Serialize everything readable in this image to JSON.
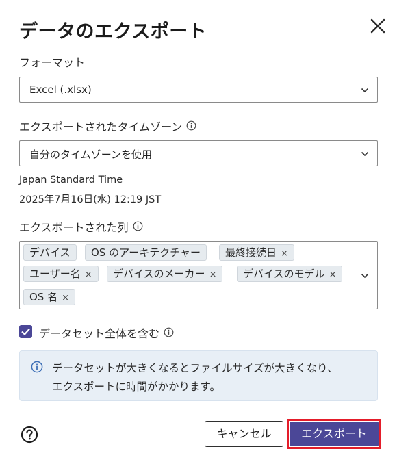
{
  "dialog": {
    "title": "データのエクスポート",
    "close_icon": "close-icon"
  },
  "format": {
    "label": "フォーマット",
    "value": "Excel (.xlsx)"
  },
  "timezone": {
    "label": "エクスポートされたタイムゾーン",
    "value": "自分のタイムゾーンを使用",
    "zone_name": "Japan Standard Time",
    "datetime": "2025年7月16日(水) 12:19 JST"
  },
  "columns": {
    "label": "エクスポートされた列",
    "chips": [
      {
        "label": "デバイス",
        "removable": false
      },
      {
        "label": "OS のアーキテクチャー",
        "removable": false
      },
      {
        "label": "最終接続日",
        "removable": true
      },
      {
        "label": "ユーザー名",
        "removable": true
      },
      {
        "label": "デバイスのメーカー",
        "removable": true
      },
      {
        "label": "デバイスのモデル",
        "removable": true
      },
      {
        "label": "OS 名",
        "removable": true
      }
    ],
    "remove_symbol": "×"
  },
  "include_all": {
    "label": "データセット全体を含む",
    "checked": true
  },
  "notice": {
    "line1": "データセットが大きくなるとファイルサイズが大きくなり、",
    "line2": "エクスポートに時間がかかります。"
  },
  "footer": {
    "help_icon": "question-circle-icon",
    "cancel_label": "キャンセル",
    "export_label": "エクスポート"
  },
  "colors": {
    "primary": "#4b4797",
    "highlight": "#e41d2a",
    "notice_bg": "#e8eff6",
    "chip_bg": "#e6ebef"
  }
}
